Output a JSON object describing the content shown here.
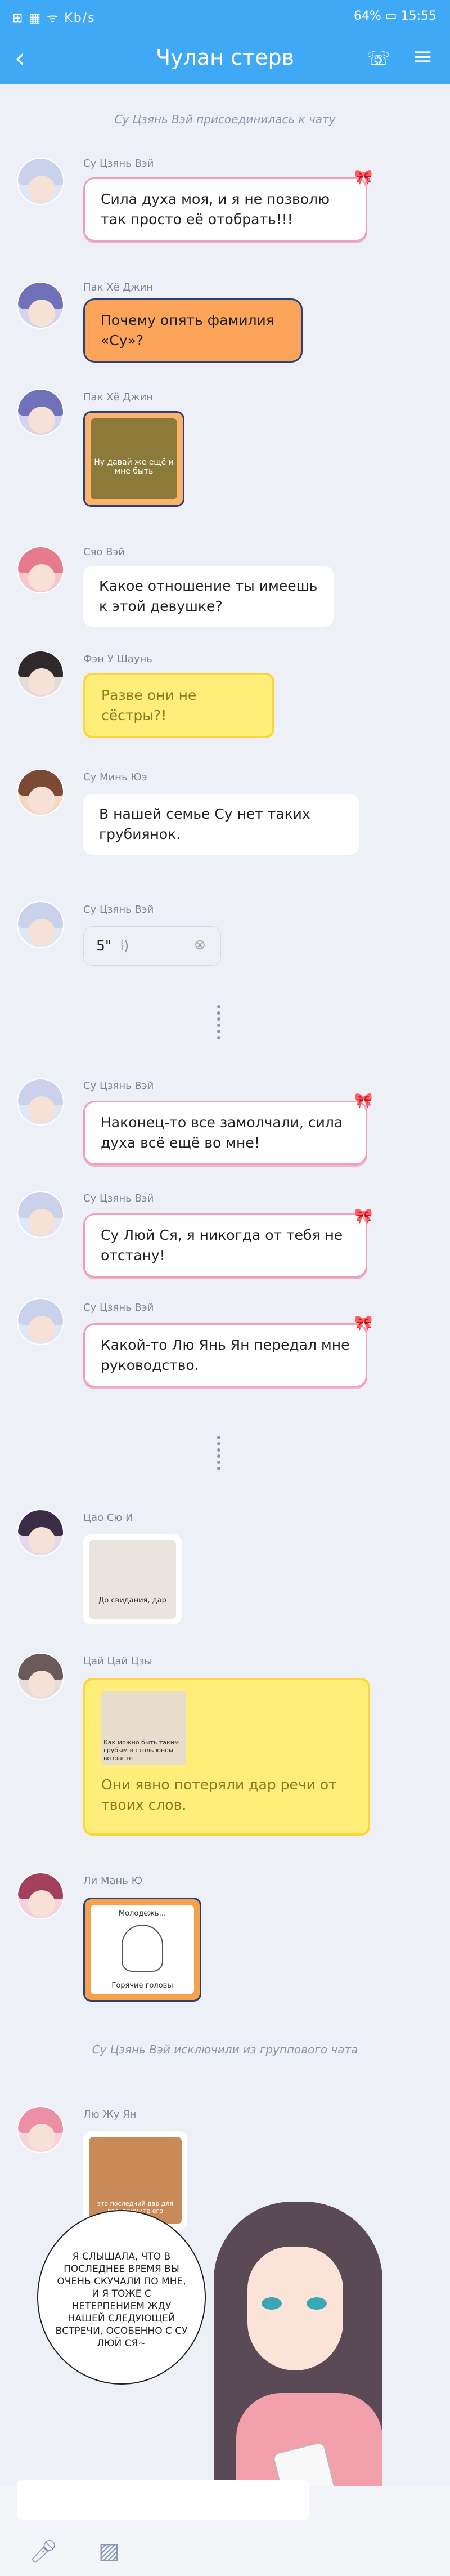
{
  "status": {
    "left": "⊞ ▦ ᯤ Kb/s",
    "battery": "64%",
    "time": "15:55"
  },
  "header": {
    "title": "Чулан стерв"
  },
  "system_messages": [
    "Су Цзянь Вэй присоединилась к чату",
    "Су Цзянь Вэй исключили из группового чата"
  ],
  "messages": [
    {
      "sender": "Су Цзянь Вэй",
      "text": "Сила духа моя, и я не позволю так просто её отобрать!!!"
    },
    {
      "sender": "Пак Хё Джин",
      "text": "Почему опять фамилия «Су»?"
    },
    {
      "sender": "Пак Хё Джин",
      "sticker": "Ну давай же ещё и мне быть"
    },
    {
      "sender": "Сяо Вэй",
      "text": "Какое отношение ты имеешь к этой девушке?"
    },
    {
      "sender": "Фэн У Шаунь",
      "text": "Разве они не сёстры?!"
    },
    {
      "sender": "Су Минь Юэ",
      "text": "В нашей семье Су нет таких грубиянок."
    },
    {
      "sender": "Су Цзянь Вэй",
      "voice": "5\""
    },
    {
      "sender": "Су Цзянь Вэй",
      "text": "Наконец-то все замолчали, сила духа всё ещё во мне!"
    },
    {
      "sender": "Су Цзянь Вэй",
      "text": "Су Люй Ся, я никогда от тебя не отстану!"
    },
    {
      "sender": "Су Цзянь Вэй",
      "text": "Какой-то Лю Янь Ян передал мне руководство."
    },
    {
      "sender": "Цао Сю И",
      "sticker": "До свидания, дар"
    },
    {
      "sender": "Цай Цай Цзы",
      "sticker": "Как можно быть таким грубым в столь юном возрасте",
      "text": "Они явно потеряли дар речи от твоих слов."
    },
    {
      "sender": "Ли Мань Ю",
      "sticker_top": "Молодежь...",
      "sticker_bottom": "Горячие головы"
    },
    {
      "sender": "Лю Жу Ян",
      "sticker": "это последний дар для вас, примите его"
    }
  ],
  "speech": "Я СЛЫШАЛА, ЧТО В ПОСЛЕДНЕЕ ВРЕМЯ ВЫ ОЧЕНЬ СКУЧАЛИ ПО МНЕ, И Я ТОЖЕ С НЕТЕРПЕНИЕМ ЖДУ НАШЕЙ СЛЕДУЮЩЕЙ ВСТРЕЧИ, ОСОБЕННО С СУ ЛЮЙ СЯ~",
  "icons": {
    "back": "back-arrow-icon",
    "phone": "phone-icon",
    "menu": "menu-icon",
    "mic": "microphone-icon",
    "image": "image-icon"
  }
}
